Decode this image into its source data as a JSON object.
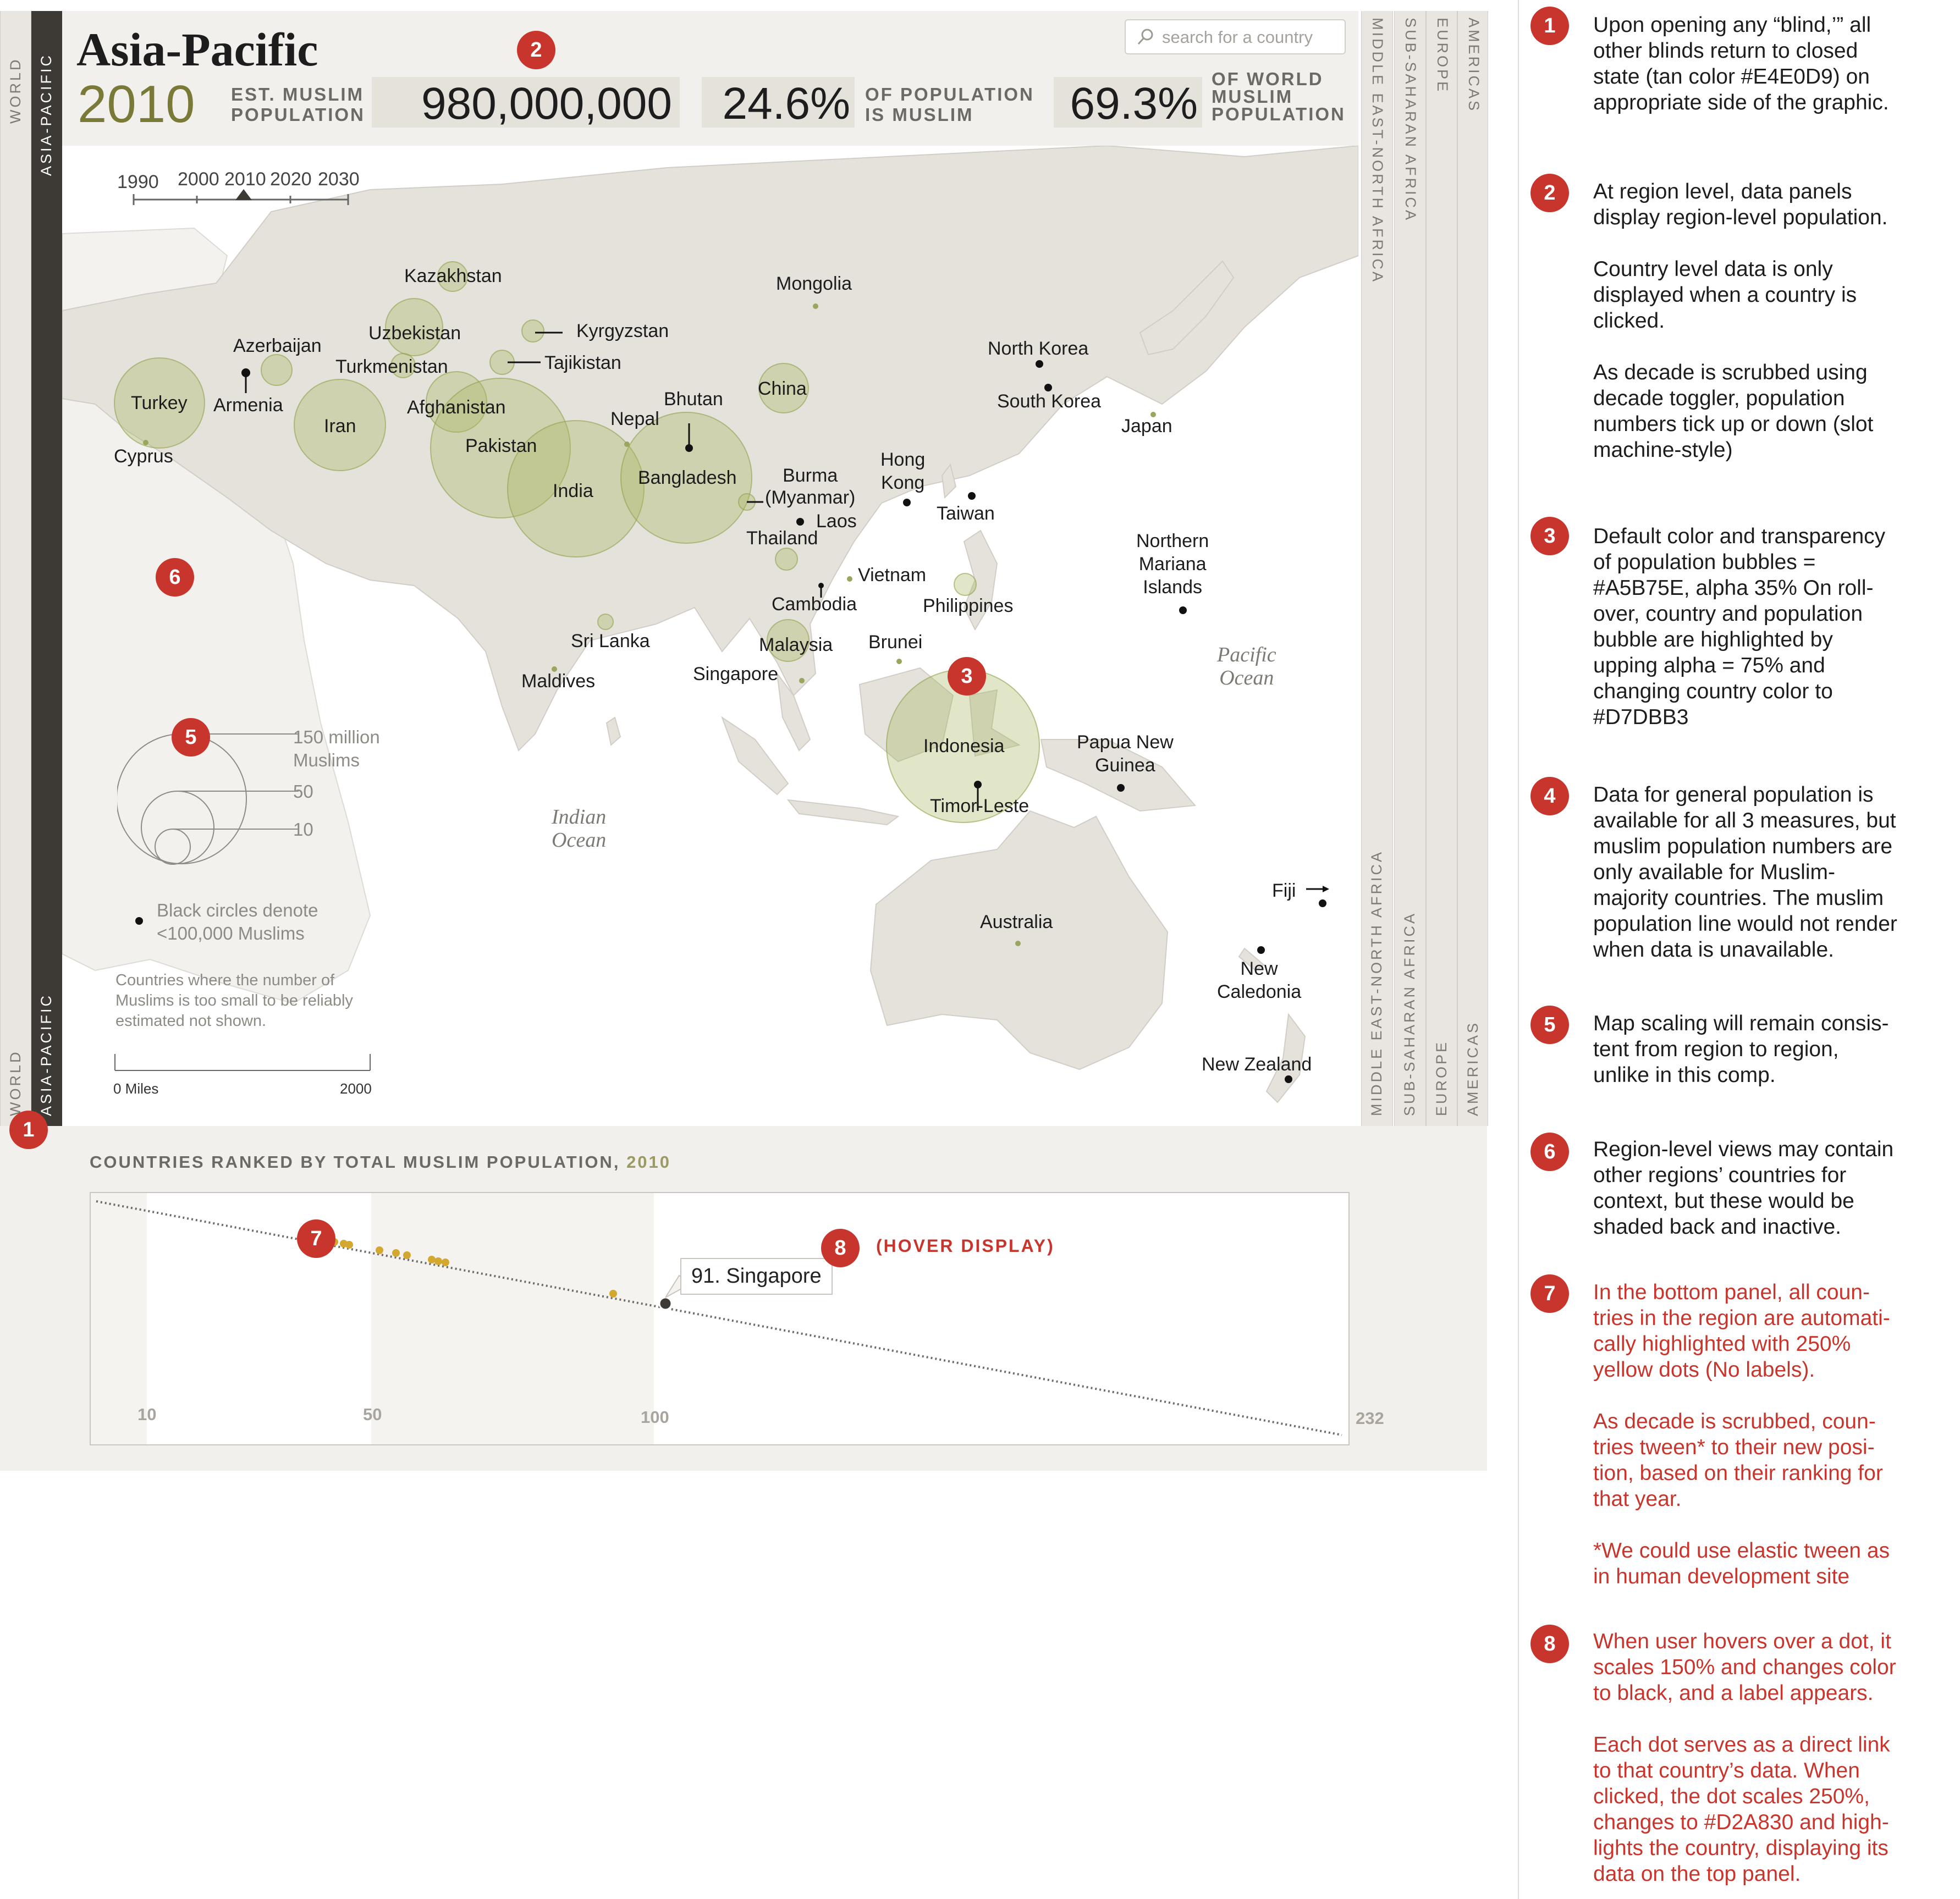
{
  "header": {
    "title": "Asia-Pacific",
    "year": "2010",
    "est_label": [
      "EST. MUSLIM",
      "POPULATION"
    ],
    "population": "980,000,000",
    "percent_muslim": "24.6%",
    "percent_label": [
      "OF POPULATION",
      "IS MUSLIM"
    ],
    "world_share": "69.3%",
    "world_label": [
      "OF WORLD",
      "MUSLIM",
      "POPULATION"
    ],
    "search_placeholder": "search for a country"
  },
  "blinds": {
    "left": [
      {
        "label": "WORLD",
        "state": "closed"
      },
      {
        "label": "ASIA-PACIFIC",
        "state": "open"
      }
    ],
    "right": [
      {
        "label": "MIDDLE EAST-NORTH AFRICA"
      },
      {
        "label": "SUB-SAHARAN AFRICA"
      },
      {
        "label": "EUROPE"
      },
      {
        "label": "AMERICAS"
      }
    ]
  },
  "timeline": {
    "decades": [
      "1990",
      "2000",
      "2010",
      "2020",
      "2030"
    ],
    "selected": "2010"
  },
  "map": {
    "countries": [
      {
        "name": "Kazakhstan"
      },
      {
        "name": "Mongolia"
      },
      {
        "name": "Azerbaijan"
      },
      {
        "name": "Uzbekistan"
      },
      {
        "name": "Kyrgyzstan"
      },
      {
        "name": "Turkmenistan"
      },
      {
        "name": "Tajikistan"
      },
      {
        "name": "Turkey"
      },
      {
        "name": "Armenia"
      },
      {
        "name": "Iran"
      },
      {
        "name": "Afghanistan"
      },
      {
        "name": "China"
      },
      {
        "name": "North Korea"
      },
      {
        "name": "South Korea"
      },
      {
        "name": "Japan"
      },
      {
        "name": "Nepal"
      },
      {
        "name": "Bhutan"
      },
      {
        "name": "Pakistan"
      },
      {
        "name": "Cyprus"
      },
      {
        "name": "India"
      },
      {
        "name": "Bangladesh"
      },
      {
        "name": "Burma\n(Myanmar)"
      },
      {
        "name": "Hong\nKong"
      },
      {
        "name": "Taiwan"
      },
      {
        "name": "Laos"
      },
      {
        "name": "Thailand"
      },
      {
        "name": "Vietnam"
      },
      {
        "name": "Northern\nMariana\nIslands"
      },
      {
        "name": "Cambodia"
      },
      {
        "name": "Philippines"
      },
      {
        "name": "Sri Lanka"
      },
      {
        "name": "Malaysia"
      },
      {
        "name": "Brunei"
      },
      {
        "name": "Maldives"
      },
      {
        "name": "Singapore"
      },
      {
        "name": "Indonesia"
      },
      {
        "name": "Papua New\nGuinea"
      },
      {
        "name": "Timor-Leste"
      },
      {
        "name": "Australia"
      },
      {
        "name": "Fiji"
      },
      {
        "name": "New\nCaledonia"
      },
      {
        "name": "New Zealand"
      }
    ],
    "oceans": [
      "Pacific\nOcean",
      "Indian\nOcean"
    ],
    "legend": {
      "sizes": [
        "150 million\nMuslims",
        "50",
        "10"
      ],
      "black_dot_note": "Black circles denote\n<100,000 Muslims",
      "small_note": "Countries where the number of\nMuslims is too small to be reliably\nestimated not shown.",
      "scale_left": "0 Miles",
      "scale_right": "2000"
    },
    "bubble_color": "#A5B75E"
  },
  "ranking": {
    "title": "COUNTRIES RANKED BY TOTAL MUSLIM POPULATION,",
    "year": "2010",
    "axis_labels": [
      "10",
      "50",
      "100",
      "232"
    ],
    "hover_label": "91. Singapore",
    "highlight_color": "#D2A830"
  },
  "annotations": {
    "markers": [
      "1",
      "2",
      "3",
      "4",
      "5",
      "6",
      "7",
      "8"
    ],
    "hover_tag": "(HOVER DISPLAY)",
    "notes": [
      {
        "num": "1",
        "color": "black",
        "text": "Upon opening any “blind,’” all\nother blinds return to closed\nstate (tan color #E4E0D9) on\nappropriate side of the graphic."
      },
      {
        "num": "2",
        "color": "black",
        "text": "At region level, data panels\ndisplay region-level population.\n\nCountry level data is only\ndisplayed when a country is\nclicked.\n\nAs decade is scrubbed using\ndecade toggler, population\nnumbers tick up or down (slot\nmachine-style)"
      },
      {
        "num": "3",
        "color": "black",
        "text": "Default color and transparency\nof population bubbles =\n#A5B75E, alpha 35% On roll-\nover, country and population\nbubble are highlighted by\nupping alpha = 75% and\nchanging country color to\n#D7DBB3"
      },
      {
        "num": "4",
        "color": "black",
        "text": "Data for general population is\navailable for all 3 measures, but\nmuslim population numbers are\nonly available for Muslim-\nmajority countries. The muslim\npopulation line would not render\nwhen data is unavailable."
      },
      {
        "num": "5",
        "color": "black",
        "text": "Map scaling will remain consis-\ntent from region to region,\nunlike in this comp."
      },
      {
        "num": "6",
        "color": "black",
        "text": "Region-level views may contain\nother regions’ countries for\ncontext, but these would be\nshaded back and inactive."
      },
      {
        "num": "7",
        "color": "red",
        "text": "In the bottom panel, all coun-\ntries in the region are automati-\ncally highlighted with 250%\nyellow dots (No labels).\n\nAs decade is scrubbed, coun-\ntries tween* to their new posi-\ntion, based on their ranking for\nthat year.\n\n*We could use elastic tween as\nin human development site"
      },
      {
        "num": "8",
        "color": "red",
        "text": "When user hovers over a dot, it\nscales 150% and changes color\nto black, and a label appears.\n\nEach dot serves as a direct link\nto that country’s data. When\nclicked, the dot scales 250%,\nchanges to #D2A830 and high-\nlights the country, displaying its\ndata on the top panel."
      }
    ]
  }
}
